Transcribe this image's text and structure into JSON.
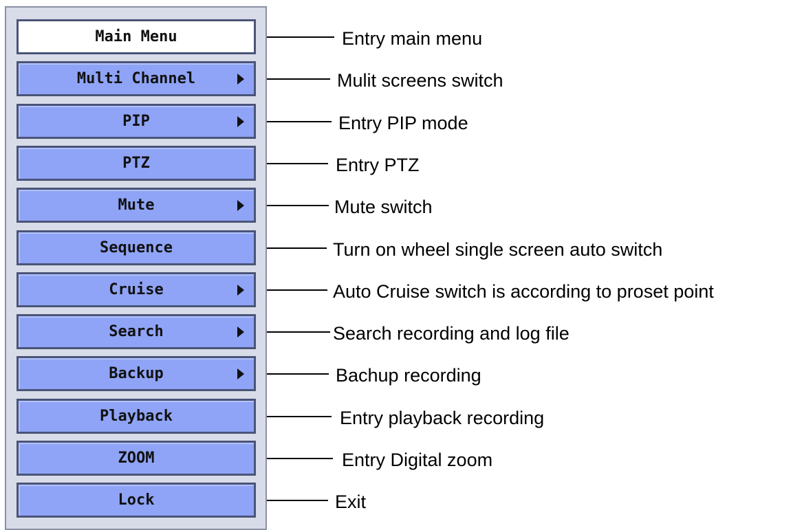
{
  "menu": {
    "items": [
      {
        "label": "Main Menu",
        "has_submenu": false,
        "active": true,
        "description": "Entry main menu"
      },
      {
        "label": "Multi Channel",
        "has_submenu": true,
        "active": false,
        "description": "Mulit screens switch"
      },
      {
        "label": "PIP",
        "has_submenu": true,
        "active": false,
        "description": "Entry PIP mode"
      },
      {
        "label": "PTZ",
        "has_submenu": false,
        "active": false,
        "description": "Entry PTZ"
      },
      {
        "label": "Mute",
        "has_submenu": true,
        "active": false,
        "description": "Mute switch"
      },
      {
        "label": "Sequence",
        "has_submenu": false,
        "active": false,
        "description": "Turn on wheel single screen auto switch"
      },
      {
        "label": "Cruise",
        "has_submenu": true,
        "active": false,
        "description": "Auto Cruise switch is according to proset point"
      },
      {
        "label": "Search",
        "has_submenu": true,
        "active": false,
        "description": "Search recording and log file"
      },
      {
        "label": "Backup",
        "has_submenu": true,
        "active": false,
        "description": "Bachup recording"
      },
      {
        "label": "Playback",
        "has_submenu": false,
        "active": false,
        "description": "Entry playback recording"
      },
      {
        "label": "ZOOM",
        "has_submenu": false,
        "active": false,
        "description": "Entry Digital zoom"
      },
      {
        "label": "Lock",
        "has_submenu": false,
        "active": false,
        "description": "Exit"
      }
    ]
  },
  "colors": {
    "button_fill": "#8fa4f6",
    "button_border": "#4a5478",
    "active_fill": "#ffffff",
    "panel_bg": "#d8dce8"
  },
  "icons": {
    "submenu": "triangle-right-icon"
  }
}
